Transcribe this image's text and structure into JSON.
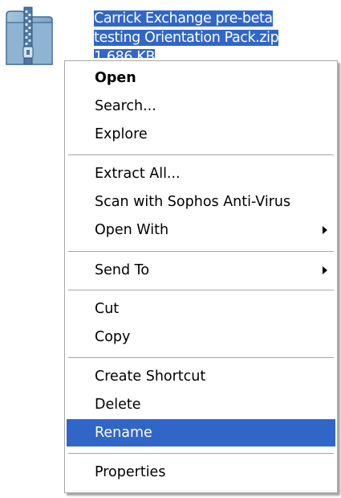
{
  "file": {
    "icon": "zip-archive-icon",
    "name_line1": "Carrick Exchange pre-beta",
    "name_line2": "testing Orientation Pack.zip",
    "name_line3": "1,686 KB"
  },
  "colors": {
    "selection": "#3166c9",
    "separator": "#a6a6a6",
    "menu_border": "#a8a8a8"
  },
  "menu": {
    "items": [
      {
        "label": "Open"
      },
      {
        "label": "Search..."
      },
      {
        "label": "Explore"
      },
      {
        "label": "Extract All..."
      },
      {
        "label": "Scan with Sophos Anti-Virus"
      },
      {
        "label": "Open With",
        "submenu": true
      },
      {
        "label": "Send To",
        "submenu": true
      },
      {
        "label": "Cut"
      },
      {
        "label": "Copy"
      },
      {
        "label": "Create Shortcut"
      },
      {
        "label": "Delete"
      },
      {
        "label": "Rename",
        "highlighted": true
      },
      {
        "label": "Properties"
      }
    ]
  }
}
